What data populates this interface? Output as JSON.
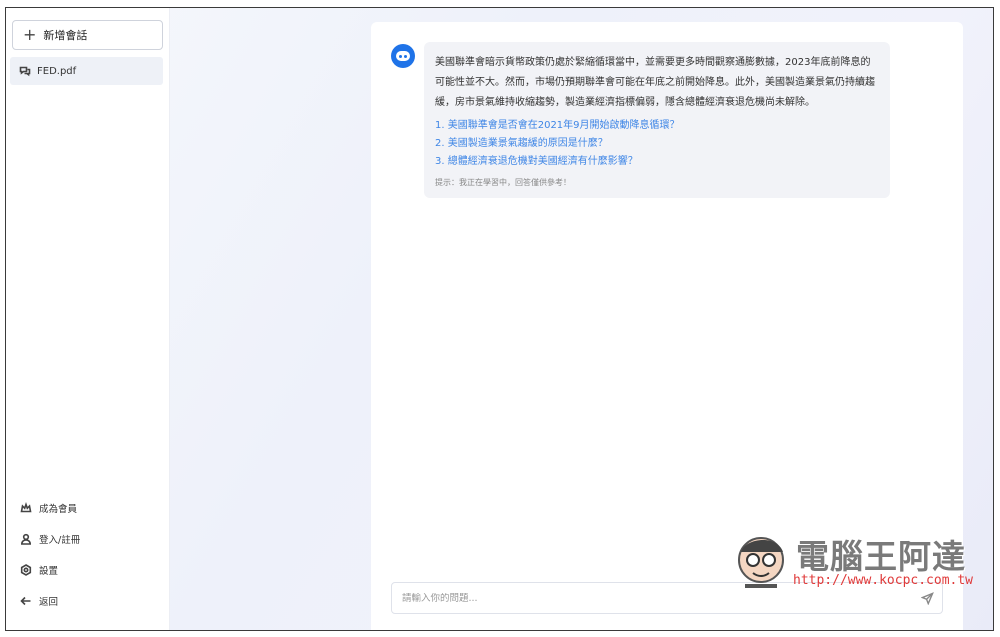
{
  "sidebar": {
    "new_chat_label": "新增會話",
    "file_name": "FED.pdf",
    "bottom": [
      {
        "label": "成為會員",
        "icon": "crown-icon"
      },
      {
        "label": "登入/註冊",
        "icon": "user-icon"
      },
      {
        "label": "設置",
        "icon": "settings-icon"
      },
      {
        "label": "返回",
        "icon": "arrow-left-icon"
      }
    ]
  },
  "chat": {
    "answer": "美國聯準會暗示貨幣政策仍處於緊縮循環當中，並需要更多時間觀察通膨數據，2023年底前降息的可能性並不大。然而，市場仍預期聯準會可能在年底之前開始降息。此外，美國製造業景氣仍持續趨緩，房市景氣維持收縮趨勢，製造業經濟指標偏弱，隱含總體經濟衰退危機尚未解除。",
    "suggestions": [
      "1. 美國聯準會是否會在2021年9月開始啟動降息循環？",
      "2. 美國製造業景氣趨緩的原因是什麼？",
      "3. 總體經濟衰退危機對美國經濟有什麼影響？"
    ],
    "hint": "提示：我正在學習中，回答僅供參考！",
    "input_placeholder": "請輸入你的問題..."
  },
  "watermark": {
    "title": "電腦王阿達",
    "url": "http://www.kocpc.com.tw"
  },
  "colors": {
    "accent": "#1f73e8",
    "link": "#3f86e6"
  }
}
